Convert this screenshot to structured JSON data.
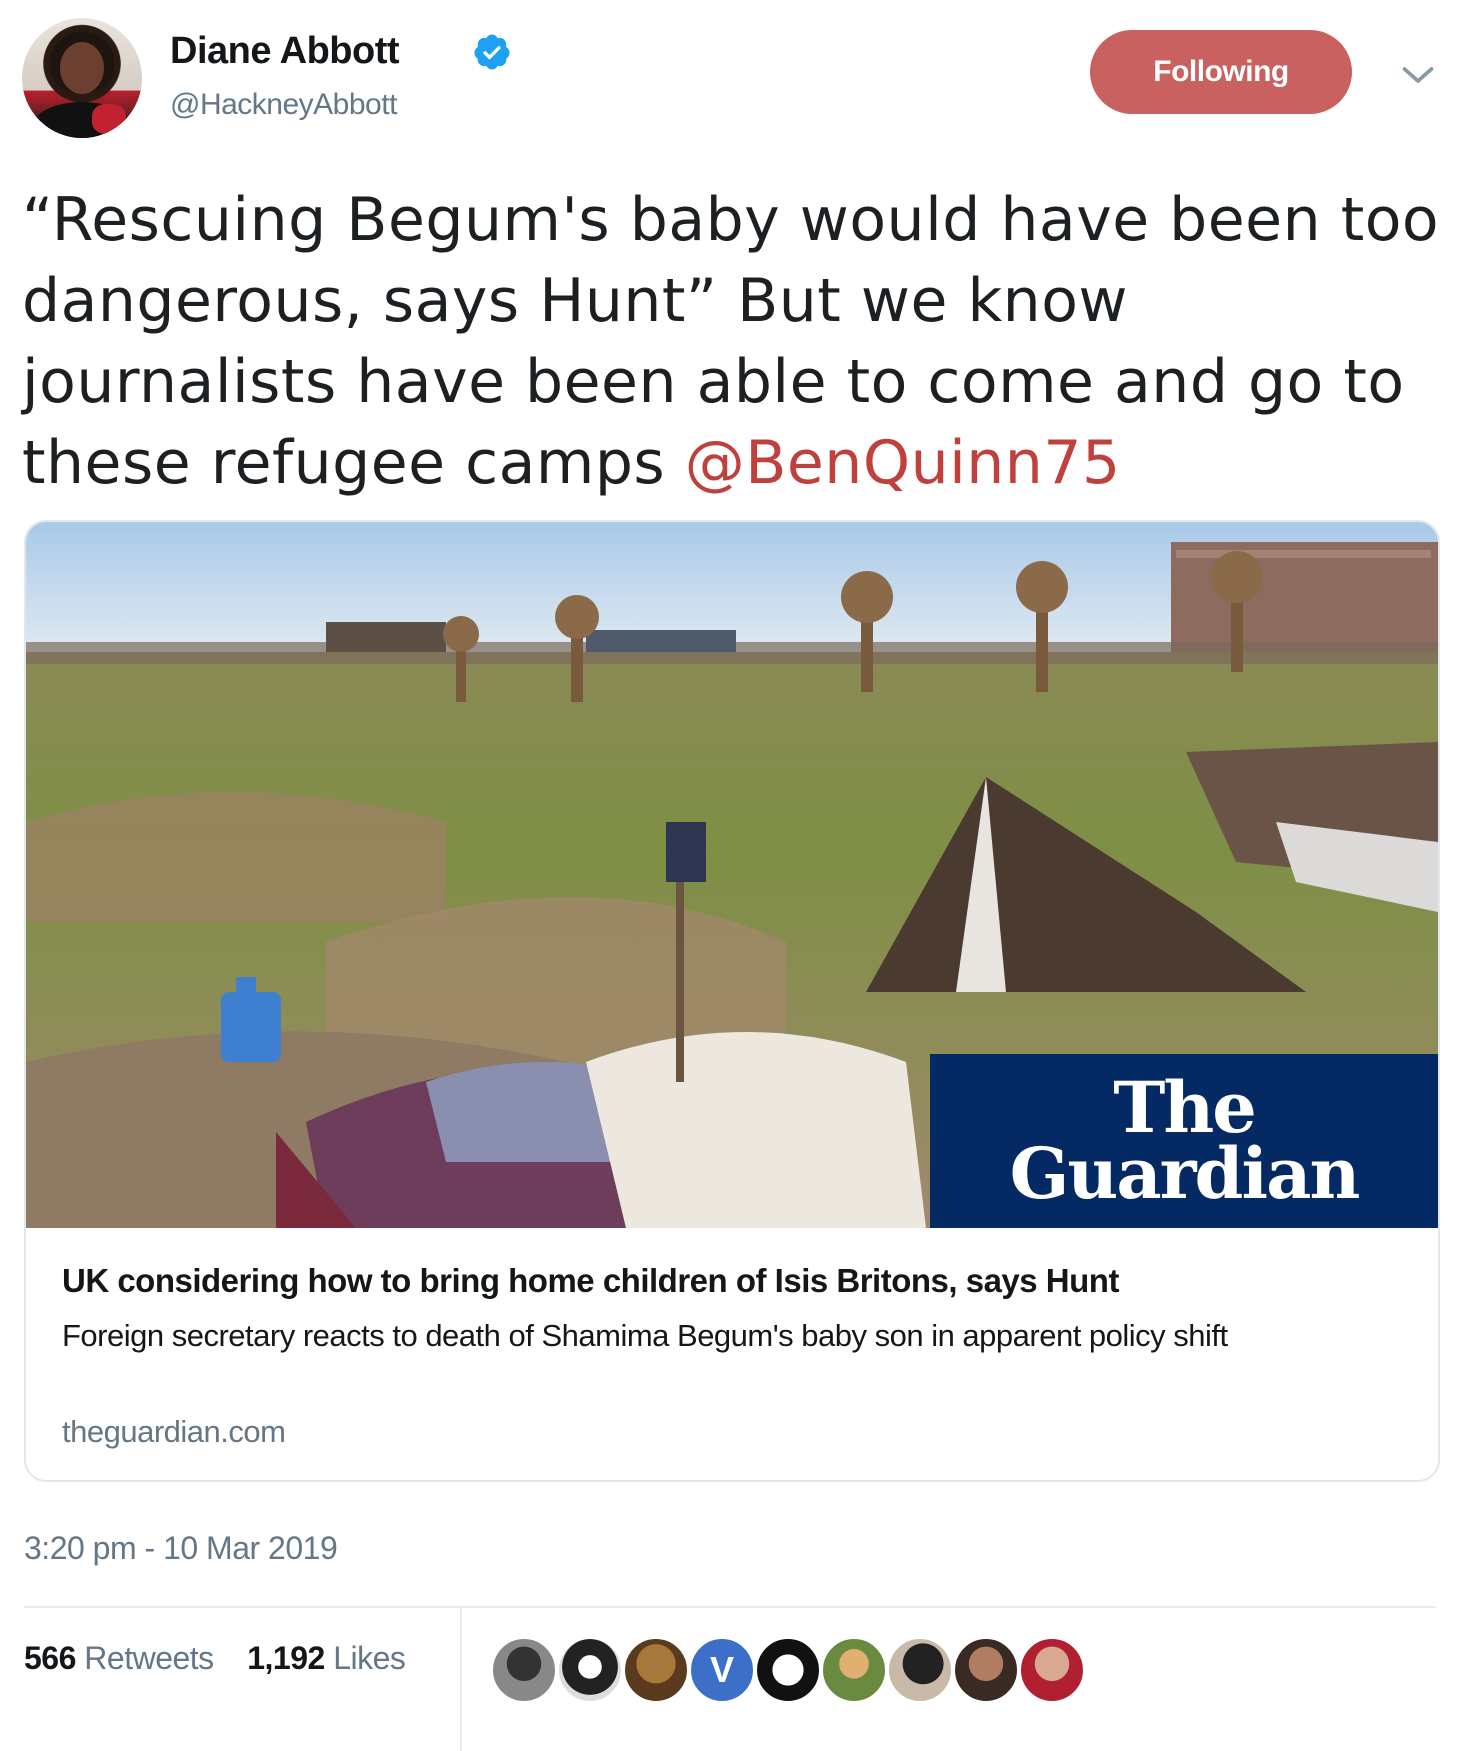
{
  "author": {
    "name": "Diane Abbott",
    "handle": "@HackneyAbbott",
    "verified": true
  },
  "follow_button_label": "Following",
  "tweet": {
    "text": "“Rescuing Begum's baby would have been too dangerous, says Hunt” But we know journalists have been able to come and go to these refugee camps ",
    "mention": "@BenQuinn75"
  },
  "card": {
    "logo_line1": "The",
    "logo_line2": "Guardian",
    "title": "UK considering how to bring home children of Isis Britons, says Hunt",
    "description": "Foreign secretary reacts to death of Shamima Begum's baby son in apparent policy shift",
    "domain": "theguardian.com"
  },
  "timestamp": "3:20 pm - 10 Mar 2019",
  "stats": {
    "retweets_count": "566",
    "retweets_label": "Retweets",
    "likes_count": "1,192",
    "likes_label": "Likes"
  },
  "colors": {
    "accent": "#c8615f",
    "mention": "#c0403e",
    "guardian_blue": "#052962",
    "secondary_text": "#657786"
  },
  "icons": [
    "verified-badge-icon",
    "chevron-down-icon"
  ]
}
